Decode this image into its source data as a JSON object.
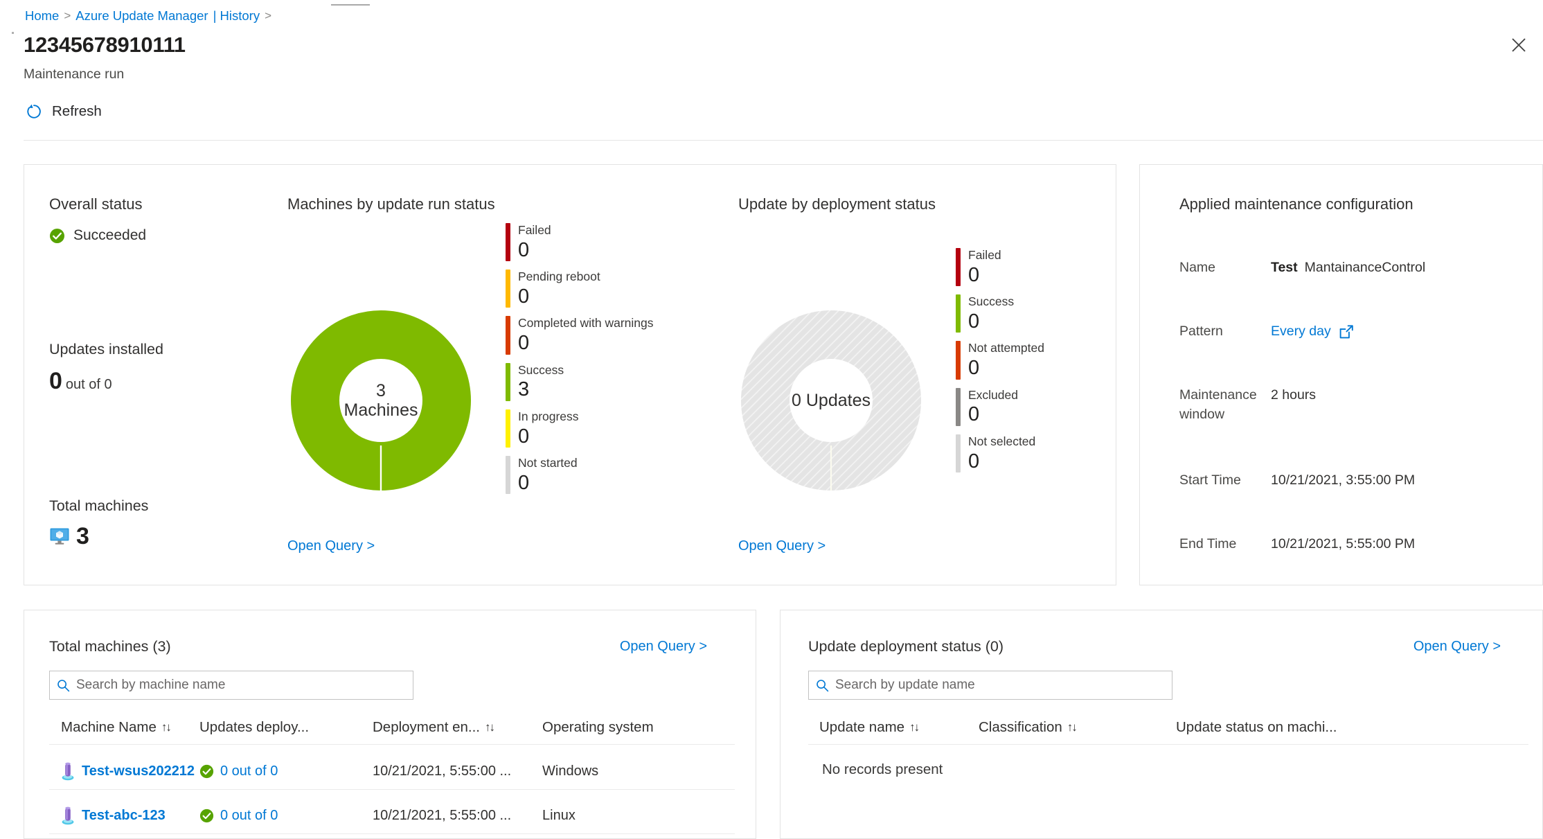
{
  "breadcrumb": {
    "home": "Home",
    "section": "Azure Update Manager",
    "subsection": "| History",
    "sep": ">"
  },
  "header": {
    "title": "12345678910111",
    "subtitle": "Maintenance run"
  },
  "toolbar": {
    "refresh_label": "Refresh"
  },
  "overall": {
    "title": "Overall status",
    "status": "Succeeded",
    "updates_installed_label": "Updates installed",
    "updates_installed_value": "0",
    "updates_installed_suffix": "out of 0",
    "total_machines_label": "Total machines",
    "total_machines_value": "3"
  },
  "chart_data": [
    {
      "type": "pie",
      "title": "Machines by update run status",
      "center_value": "3",
      "center_label": "Machines",
      "total": 3,
      "legend_position": "right",
      "categories": [
        "Failed",
        "Pending reboot",
        "Completed with warnings",
        "Success",
        "In progress",
        "Not started"
      ],
      "values": [
        0,
        0,
        0,
        3,
        0,
        0
      ],
      "colors": [
        "#B4000F",
        "#FFB900",
        "#D83B01",
        "#7FBA00",
        "#FFF100",
        "#D6D6D6"
      ],
      "link": "Open Query >"
    },
    {
      "type": "pie",
      "title": "Update by deployment status",
      "center_value": "0 Updates",
      "center_label": "",
      "total": 0,
      "legend_position": "right",
      "categories": [
        "Failed",
        "Success",
        "Not attempted",
        "Excluded",
        "Not selected"
      ],
      "values": [
        0,
        0,
        0,
        0,
        0
      ],
      "colors": [
        "#B4000F",
        "#7FBA00",
        "#D83B01",
        "#8A8886",
        "#D6D6D6"
      ],
      "empty_color": "#E4E4E4",
      "link": "Open Query >"
    }
  ],
  "config": {
    "title": "Applied maintenance configuration",
    "rows": [
      {
        "key": "Name",
        "bold": "Test",
        "value": "MantainanceControl"
      },
      {
        "key": "Pattern",
        "link": "Every day"
      },
      {
        "key": "Maintenance window",
        "value": "2 hours"
      },
      {
        "key": "Start Time",
        "value": "10/21/2021, 3:55:00 PM"
      },
      {
        "key": "End Time",
        "value": "10/21/2021, 5:55:00 PM"
      }
    ]
  },
  "machines_table": {
    "title": "Total machines (3)",
    "open_query": "Open Query >",
    "search_placeholder": "Search by machine name",
    "search_value": "",
    "columns": [
      "Machine Name",
      "Updates deploy...",
      "Deployment en...",
      "Operating system"
    ],
    "rows": [
      {
        "name": "Test-wsus202212 ...",
        "updates": "0 out of 0",
        "deployment_end": "10/21/2021, 5:55:00 ...",
        "os": "Windows"
      },
      {
        "name": "Test-abc-123",
        "updates": "0 out of 0",
        "deployment_end": "10/21/2021, 5:55:00 ...",
        "os": "Linux"
      }
    ]
  },
  "updates_table": {
    "title": "Update deployment status (0)",
    "open_query": "Open Query >",
    "search_placeholder": "Search by update name",
    "search_value": "",
    "columns": [
      "Update name",
      "Classification",
      "Update status on machi..."
    ],
    "empty_message": "No records present"
  }
}
